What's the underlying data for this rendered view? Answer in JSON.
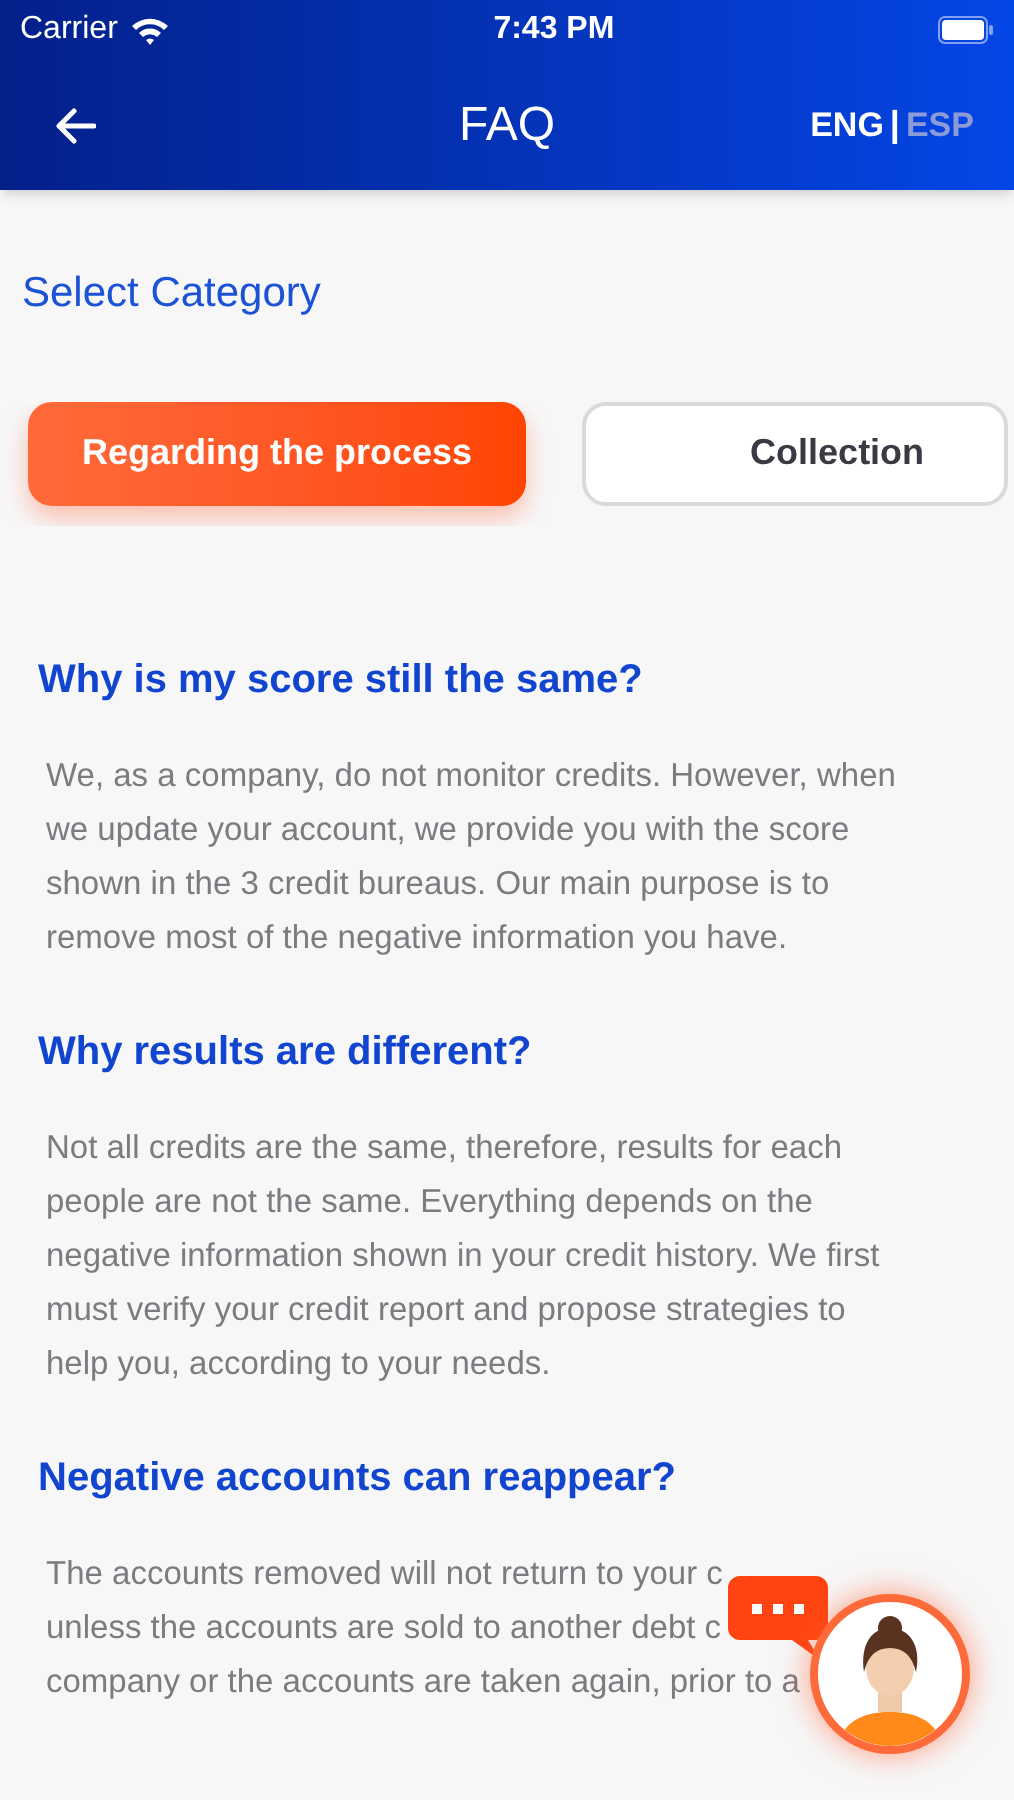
{
  "status_bar": {
    "carrier": "Carrier",
    "time": "7:43 PM"
  },
  "header": {
    "title": "FAQ",
    "languages": [
      {
        "label": "ENG",
        "selected": true
      },
      {
        "label": "ESP",
        "selected": false
      }
    ],
    "separator": "|"
  },
  "category_title": "Select Category",
  "categories": [
    {
      "label": "Regarding the process",
      "selected": true
    },
    {
      "label": "Collection",
      "selected": false
    }
  ],
  "faqs": [
    {
      "question": "Why is my score still the same?",
      "answer_lines": [
        "We, as a company, do not monitor credits. However, when",
        "we update your account, we provide you with the score",
        "shown in the 3 credit bureaus. Our main purpose is to",
        "remove most of the negative information you have."
      ]
    },
    {
      "question": "Why results are different?",
      "answer_lines": [
        "Not all credits are the same, therefore, results for each",
        "people are not the same. Everything depends on the",
        "negative information shown in your credit history. We first",
        "must verify your credit report and propose strategies to",
        "help you, according to your needs."
      ]
    },
    {
      "question": "Negative accounts can reappear?",
      "answer_lines": [
        "The accounts removed will not return to your c",
        "unless the accounts are sold to another debt c",
        "company or the accounts are taken again, prior to a"
      ]
    }
  ]
}
